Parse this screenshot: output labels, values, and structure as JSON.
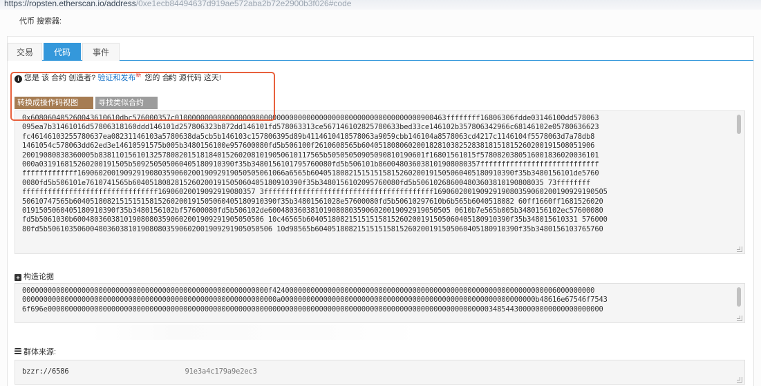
{
  "browser": {
    "url": "https://ropsten.etherscan.io/address",
    "url_faded": "/0xe1ecb84494637d919ae572aba2b72e2900b3f026#code"
  },
  "token_search": "代币 搜索器:",
  "tabs": [
    {
      "label": "交易",
      "active": false
    },
    {
      "label": "代码",
      "active": true
    },
    {
      "label": "事件",
      "active": false
    }
  ],
  "notice": {
    "prefix": "您是 该 合约 创造者?",
    "link": "验证和发布",
    "badge": "新",
    "suffix_1": "您的 合",
    "suffix_2": "约 源代码 这天!"
  },
  "buttons": {
    "opcode_view": "转换成操作码视图",
    "find_similar": "寻找类似合约"
  },
  "bytecode_lines": [
    "0x608060405260043610610dbc576000357c0100000000000000000000000000000000000000000000000000000000900463ffffffff16806306fdde03146100dd578063",
    "095ea7b31461016d57806318160ddd146101d257806323b872dd146101fd578063313ce567146102825780633bed33ce146102b357806342966c68146102e05780636623",
    "fc46146103255780637ea08231146103a5780638da5cb5b146103c157806395d89b4114610418578063a9059cbb146104a8578063cd4217c1146104f5578063d7a78db8",
    "1461054c578063dd62ed3e14610591575b005b3480156100e957600080fd5b506100f2610608565b6040518080602001828103825283818151815260200191508051906",
    "20019080838360005b83811015610132578082015181840152602081019050610117565b50505050905090810190601f16801561015f5780820380516001836020036101",
    "000a031916815260200191505b509250505060405180910390f35b3480156101795760080fd5b506101b860048036038101908080357ffffffffffffffffffffffffffff",
    "fffffffffffff1690602001909291908035906020019092919050505061066a6565b604051808215151515815260200191505060405180910390f35b3480156101de5760",
    "0080fd5b506101e7610741565b6040518082815260200191505060405180910390f35b3480156102095760080fd5b506102686004803603810190808035 73ffffffff",
    "ffffffffffffffffffffffffffffffff16906020019092919080357 3ffffffffffffffffffffffffffffffffffffffff16906020019092919080359060200190929190505",
    "50610747565b604051808215151515815260200191505060405180910390f35b34801561028e57600080fd5b50610297610b6b565b6040518082 60ff1660ff1681526020",
    "0191505060405180910390f35b3480156102bf57600080fd5b506102de6004803603810190808035906020019092919050505 0610b7e565b005b3480156102ec57600080",
    "fd5b5061030b600480360381019080803590602001909291905050506 10c46565b604051808215151515815260200191505060405180910390f35b348015610331 576000",
    "80fd5b50610350600480360381019080803590602001909291905050506 10d98565b604051808215151515815260200191505060405180910390f35b3480156103765760"
  ],
  "constructor_args": {
    "label": "构造论据",
    "lines": [
      "0000000000000000000000000000000000000000000000000000000000f4240000000000000000000000000000000000000000000000000000000000000006000000000",
      "000000000000000000000000000000000000000000000000000000000000a000000000000000000000000000000000000000000000000000000000000b48616e67546f7543",
      "6f696e00000000000000000000000000000000000000000000000000000000000000000000000000000000000000000000000000000000348544300000000000000000000"
    ]
  },
  "swarm": {
    "label": "群体来源:",
    "value_start": "bzzr://6586",
    "value_end": "91e3a4c179a9e2ec3"
  }
}
